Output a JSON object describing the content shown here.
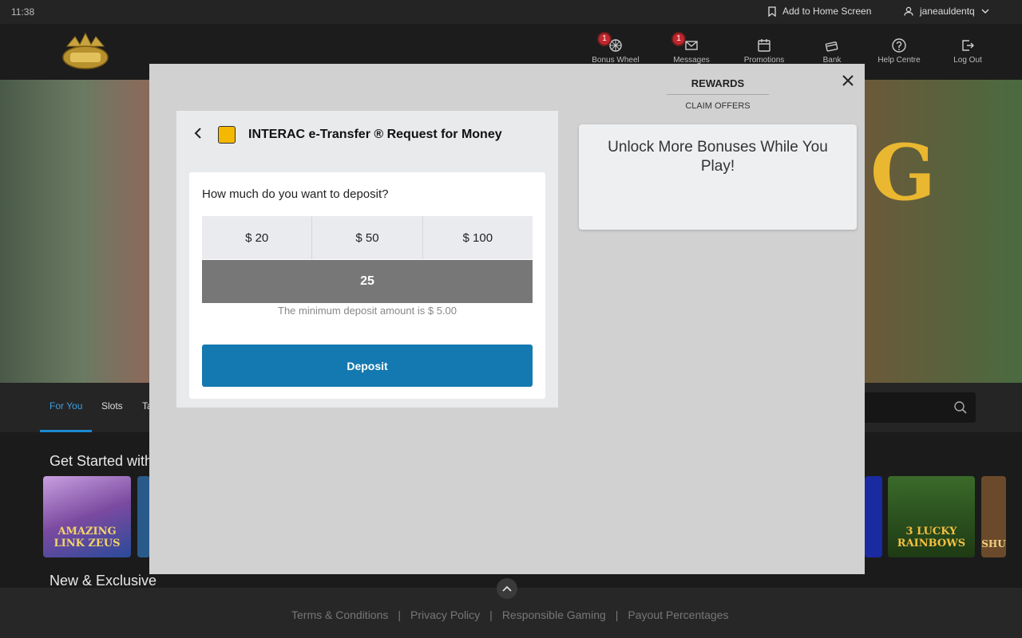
{
  "status_bar": {
    "time": "11:38",
    "add_home": "Add to Home Screen",
    "username": "janeauldentq"
  },
  "header": {
    "nav": [
      {
        "label": "Bonus Wheel",
        "icon": "wheel-icon",
        "badge": "1"
      },
      {
        "label": "Messages",
        "icon": "mail-icon",
        "badge": "1"
      },
      {
        "label": "Promotions",
        "icon": "calendar-icon"
      },
      {
        "label": "Bank",
        "icon": "bank-cards-icon"
      },
      {
        "label": "Help Centre",
        "icon": "help-icon"
      },
      {
        "label": "Log Out",
        "icon": "logout-icon"
      }
    ]
  },
  "tabs": {
    "items": [
      "For You",
      "Slots",
      "Ta"
    ]
  },
  "content": {
    "section1_title": "Get Started with",
    "section2_title": "New & Exclusive",
    "tiles": [
      {
        "label": "AMAZING LINK ZEUS"
      },
      {
        "label": "3 LUCKY RAINBOWS"
      },
      {
        "label": "SHU"
      }
    ]
  },
  "footer": {
    "links": [
      "Terms & Conditions",
      "Privacy Policy",
      "Responsible Gaming",
      "Payout Percentages"
    ],
    "separator": "|"
  },
  "modal": {
    "rewards_title": "REWARDS",
    "rewards_subtitle": "CLAIM OFFERS",
    "promo_text": "Unlock More Bonuses While You Play!",
    "deposit": {
      "title": "INTERAC e-Transfer ® Request for Money",
      "question": "How much do you want to deposit?",
      "amounts": [
        "$ 20",
        "$ 50",
        "$ 100"
      ],
      "input_value": "25",
      "min_note": "The minimum deposit amount is $ 5.00",
      "button_label": "Deposit"
    }
  },
  "colors": {
    "accent": "#1479b0",
    "active_tab": "#3ba0e0",
    "badge": "#c1272d",
    "modal_bg": "#d1d1d1"
  }
}
